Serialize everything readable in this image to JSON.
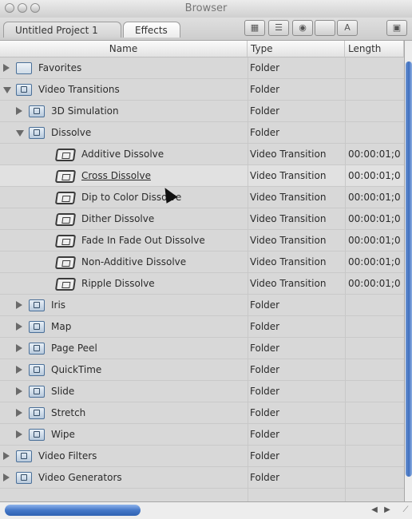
{
  "window": {
    "title": "Browser"
  },
  "tabs": [
    {
      "label": "Untitled Project 1"
    },
    {
      "label": "Effects"
    }
  ],
  "toolbar": {
    "icons": [
      "view-icon",
      "list-icon",
      "effects-icon",
      "blank-icon",
      "text-icon",
      "grid-icon"
    ]
  },
  "columns": {
    "name": "Name",
    "type": "Type",
    "length": "Length"
  },
  "rows": [
    {
      "name": "Favorites",
      "type": "Folder",
      "length": ""
    },
    {
      "name": "Video Transitions",
      "type": "Folder",
      "length": ""
    },
    {
      "name": "3D Simulation",
      "type": "Folder",
      "length": ""
    },
    {
      "name": "Dissolve",
      "type": "Folder",
      "length": ""
    },
    {
      "name": "Additive Dissolve",
      "type": "Video Transition",
      "length": "00:00:01;0"
    },
    {
      "name": "Cross Dissolve",
      "type": "Video Transition",
      "length": "00:00:01;0"
    },
    {
      "name": "Dip to Color Dissolve",
      "type": "Video Transition",
      "length": "00:00:01;0"
    },
    {
      "name": "Dither Dissolve",
      "type": "Video Transition",
      "length": "00:00:01;0"
    },
    {
      "name": "Fade In Fade Out Dissolve",
      "type": "Video Transition",
      "length": "00:00:01;0"
    },
    {
      "name": "Non-Additive Dissolve",
      "type": "Video Transition",
      "length": "00:00:01;0"
    },
    {
      "name": "Ripple Dissolve",
      "type": "Video Transition",
      "length": "00:00:01;0"
    },
    {
      "name": "Iris",
      "type": "Folder",
      "length": ""
    },
    {
      "name": "Map",
      "type": "Folder",
      "length": ""
    },
    {
      "name": "Page Peel",
      "type": "Folder",
      "length": ""
    },
    {
      "name": "QuickTime",
      "type": "Folder",
      "length": ""
    },
    {
      "name": "Slide",
      "type": "Folder",
      "length": ""
    },
    {
      "name": "Stretch",
      "type": "Folder",
      "length": ""
    },
    {
      "name": "Wipe",
      "type": "Folder",
      "length": ""
    },
    {
      "name": "Video Filters",
      "type": "Folder",
      "length": ""
    },
    {
      "name": "Video Generators",
      "type": "Folder",
      "length": ""
    }
  ]
}
